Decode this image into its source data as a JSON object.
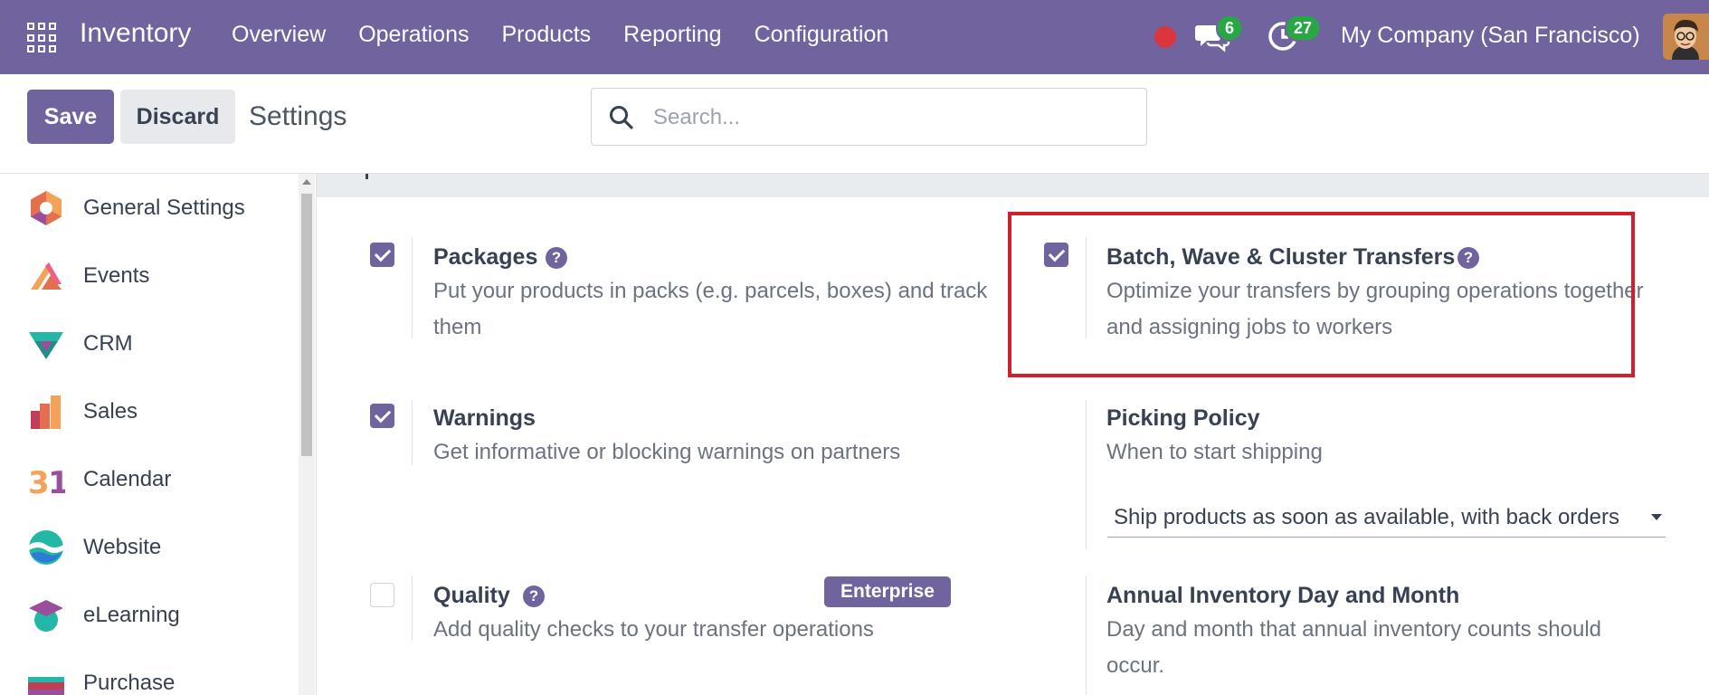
{
  "topbar": {
    "brand": "Inventory",
    "menu": [
      "Overview",
      "Operations",
      "Products",
      "Reporting",
      "Configuration"
    ],
    "messages_count": "6",
    "activities_count": "27",
    "company": "My Company (San Francisco)"
  },
  "controlbar": {
    "save_label": "Save",
    "discard_label": "Discard",
    "title": "Settings",
    "search_placeholder": "Search..."
  },
  "sidebar": {
    "items": [
      {
        "label": "General Settings",
        "icon": "general-settings-icon"
      },
      {
        "label": "Events",
        "icon": "events-icon"
      },
      {
        "label": "CRM",
        "icon": "crm-icon"
      },
      {
        "label": "Sales",
        "icon": "sales-icon"
      },
      {
        "label": "Calendar",
        "icon": "calendar-icon"
      },
      {
        "label": "Website",
        "icon": "website-icon"
      },
      {
        "label": "eLearning",
        "icon": "elearning-icon"
      },
      {
        "label": "Purchase",
        "icon": "purchase-icon"
      }
    ]
  },
  "settings": {
    "packages": {
      "title": "Packages",
      "desc": "Put your products in packs (e.g. parcels, boxes) and track them",
      "checked": true
    },
    "batch": {
      "title": "Batch, Wave & Cluster Transfers",
      "desc": "Optimize your transfers by grouping operations together and assigning jobs to workers",
      "checked": true
    },
    "warnings": {
      "title": "Warnings",
      "desc": "Get informative or blocking warnings on partners",
      "checked": true
    },
    "picking": {
      "title": "Picking Policy",
      "desc": "When to start shipping",
      "selected": "Ship products as soon as available, with back orders"
    },
    "quality": {
      "title": "Quality",
      "desc": "Add quality checks to your transfer operations",
      "badge": "Enterprise",
      "checked": false
    },
    "annual": {
      "title": "Annual Inventory Day and Month",
      "desc": "Day and month that annual inventory counts should occur."
    }
  },
  "colors": {
    "brand": "#71639e",
    "highlight": "#d0202e",
    "badge": "#28a745"
  }
}
